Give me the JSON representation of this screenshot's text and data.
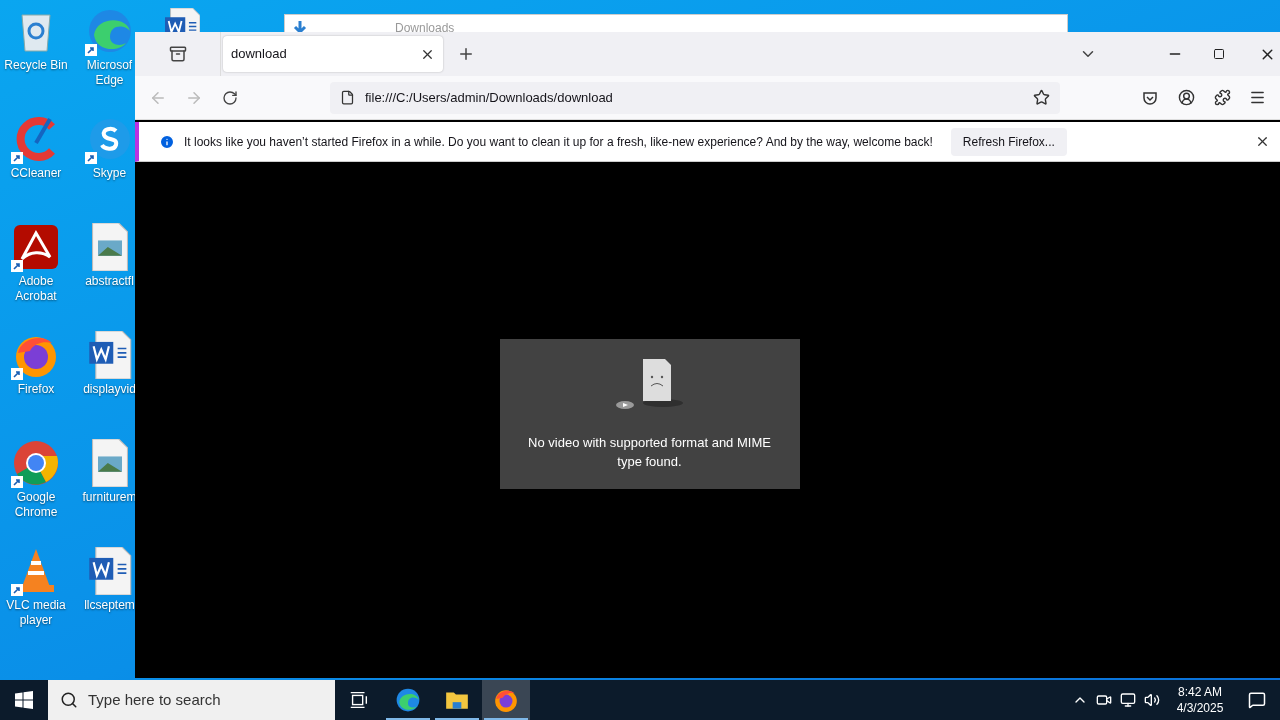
{
  "desktop_icons": [
    {
      "kind": "recycle",
      "lines": [
        "Recycle Bin"
      ],
      "shortcut": false
    },
    {
      "kind": "edge",
      "lines": [
        "Microsof",
        "Edge"
      ],
      "shortcut": true
    },
    {
      "kind": "ccleaner",
      "lines": [
        "CCleaner"
      ],
      "shortcut": true
    },
    {
      "kind": "skype",
      "lines": [
        "Skype"
      ],
      "shortcut": true
    },
    {
      "kind": "acrobat",
      "lines": [
        "Adobe",
        "Acrobat"
      ],
      "shortcut": true
    },
    {
      "kind": "image",
      "lines": [
        "abstractfl"
      ],
      "shortcut": false
    },
    {
      "kind": "firefox",
      "lines": [
        "Firefox"
      ],
      "shortcut": true
    },
    {
      "kind": "word",
      "lines": [
        "displayvid"
      ],
      "shortcut": false
    },
    {
      "kind": "chrome",
      "lines": [
        "Google",
        "Chrome"
      ],
      "shortcut": true
    },
    {
      "kind": "image",
      "lines": [
        "furniturem"
      ],
      "shortcut": false
    },
    {
      "kind": "vlc",
      "lines": [
        "VLC media",
        "player"
      ],
      "shortcut": true
    },
    {
      "kind": "word",
      "lines": [
        "llcseptem"
      ],
      "shortcut": false
    }
  ],
  "background_window": {
    "title": "Downloads"
  },
  "browser": {
    "tabs": [
      {
        "label": "download",
        "selected": true
      }
    ],
    "address": "file:///C:/Users/admin/Downloads/download",
    "notification": {
      "message": "It looks like you haven’t started Firefox in a while. Do you want to clean it up for a fresh, like-new experience? And by the way, welcome back!",
      "button": "Refresh Firefox..."
    },
    "error": {
      "message": "No video with supported format and MIME type found."
    }
  },
  "taskbar": {
    "search_placeholder": "Type here to search",
    "apps": [
      {
        "kind": "taskview",
        "running": false,
        "selected": false
      },
      {
        "kind": "edge",
        "running": true,
        "selected": false
      },
      {
        "kind": "explorer",
        "running": true,
        "selected": false
      },
      {
        "kind": "firefox",
        "running": true,
        "selected": true
      }
    ],
    "time": "8:42 AM",
    "date": "4/3/2025"
  }
}
